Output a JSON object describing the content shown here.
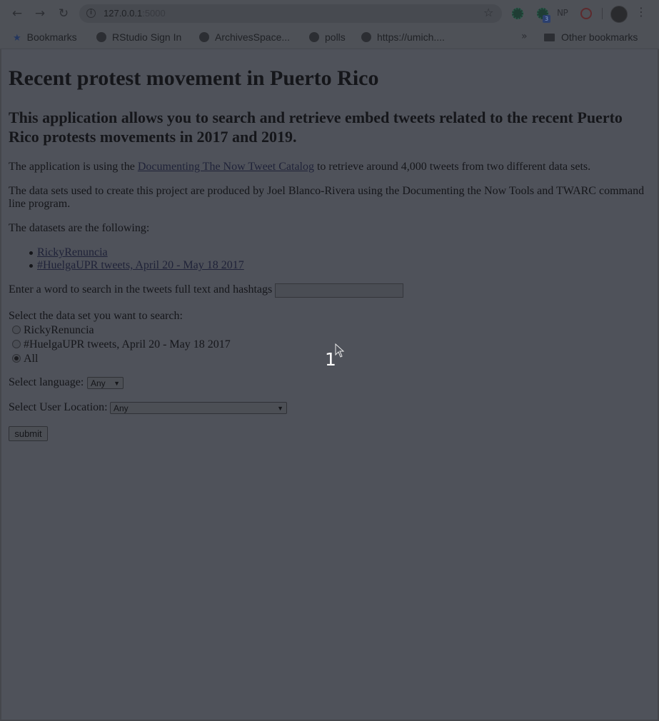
{
  "browser": {
    "url_host": "127.0.0.1",
    "url_port": ":5000",
    "extension_np_label": "NP",
    "extension_badge": "3",
    "bookmarks": [
      {
        "label": "Bookmarks",
        "icon": "star-icon"
      },
      {
        "label": "RStudio Sign In",
        "icon": "rstudio-icon"
      },
      {
        "label": "ArchivesSpace...",
        "icon": "globe-icon"
      },
      {
        "label": "polls",
        "icon": "globe-icon"
      },
      {
        "label": "https://umich....",
        "icon": "globe-icon"
      }
    ],
    "more_bookmarks": "»",
    "other_bookmarks": "Other bookmarks"
  },
  "page": {
    "title": "Recent protest movement in Puerto Rico",
    "subtitle": "This application allows you to search and retrieve embed tweets related to the recent Puerto Rico protests movements in 2017 and 2019.",
    "intro_before": "The application is using the ",
    "intro_link": "Documenting The Now Tweet Catalog",
    "intro_after": " to retrieve around 4,000 tweets from two different data sets.",
    "datasets_source": "The data sets used to create this project are produced by Joel Blanco-Rivera using the Documenting the Now Tools and TWARC command line program.",
    "datasets_heading": "The datasets are the following:",
    "dataset_links": [
      "RickyRenuncia",
      "#HuelgaUPR tweets, April 20 - May 18 2017"
    ],
    "search_label": "Enter a word to search in the tweets full text and hashtags",
    "search_value": "",
    "dataset_select_label": "Select the data set you want to search:",
    "dataset_options": [
      "RickyRenuncia",
      "#HuelgaUPR tweets, April 20 - May 18 2017",
      "All"
    ],
    "dataset_selected": "All",
    "language_label": "Select language:",
    "language_value": "Any",
    "location_label": "Select User Location:",
    "location_value": "Any",
    "submit_label": "submit"
  },
  "overlay": {
    "click_marker": "1"
  }
}
